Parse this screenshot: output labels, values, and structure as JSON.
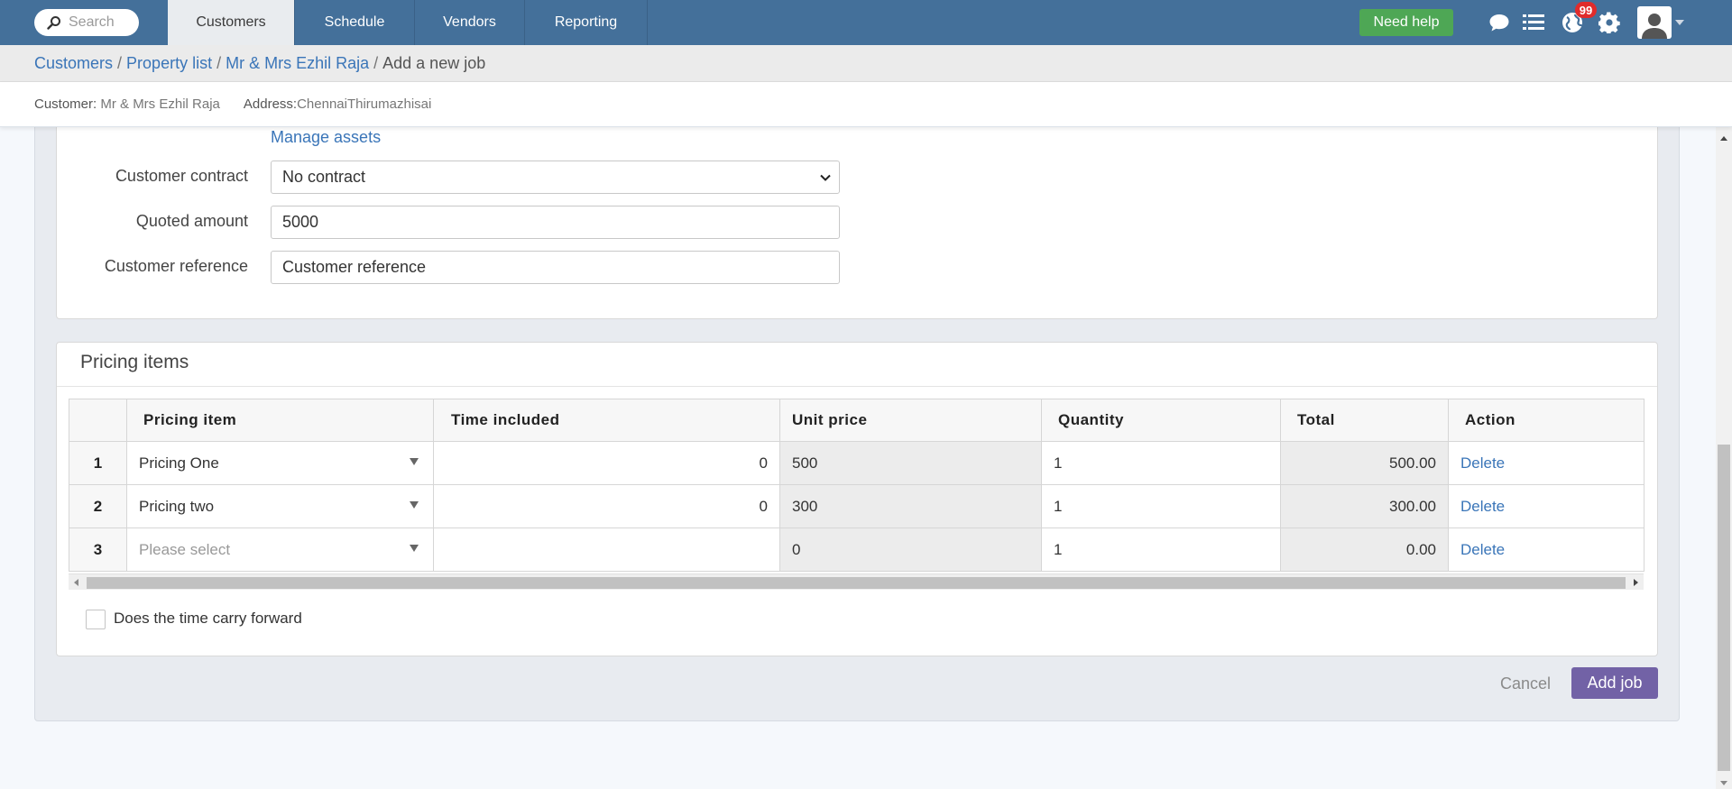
{
  "header": {
    "search_placeholder": "Search",
    "tabs": [
      {
        "label": "Customers"
      },
      {
        "label": "Schedule"
      },
      {
        "label": "Vendors"
      },
      {
        "label": "Reporting"
      }
    ],
    "need_help": "Need help",
    "notification_count": "99",
    "colors": {
      "bar": "#44709a",
      "help": "#4ea755",
      "badge": "#e02b2b"
    }
  },
  "breadcrumb": {
    "items": [
      "Customers",
      "Property list",
      "Mr & Mrs Ezhil Raja"
    ],
    "separator": "/",
    "current": "Add a new job"
  },
  "info": {
    "customer_label": "Customer:",
    "customer_value": "Mr & Mrs Ezhil Raja",
    "address_label": "Address:",
    "address_value": "ChennaiThirumazhisai"
  },
  "form": {
    "manage_assets": "Manage assets",
    "contract_label": "Customer contract",
    "contract_value": "No contract",
    "quoted_label": "Quoted amount",
    "quoted_value": "5000",
    "reference_label": "Customer reference",
    "reference_placeholder": "Customer reference"
  },
  "pricing": {
    "title": "Pricing items",
    "columns": [
      "",
      "Pricing item",
      "Time included",
      "Unit price",
      "Quantity",
      "Total",
      "Action"
    ],
    "rows": [
      {
        "num": "1",
        "item": "Pricing One",
        "time": "0",
        "unit": "500",
        "qty": "1",
        "total": "500.00",
        "action": "Delete"
      },
      {
        "num": "2",
        "item": "Pricing two",
        "time": "0",
        "unit": "300",
        "qty": "1",
        "total": "300.00",
        "action": "Delete"
      },
      {
        "num": "3",
        "item": "Please select",
        "time": "",
        "unit": "0",
        "qty": "1",
        "total": "0.00",
        "action": "Delete"
      }
    ],
    "carry_forward_label": "Does the time carry forward"
  },
  "actions": {
    "cancel": "Cancel",
    "add_job": "Add job",
    "add_job_color": "#7262a6"
  }
}
